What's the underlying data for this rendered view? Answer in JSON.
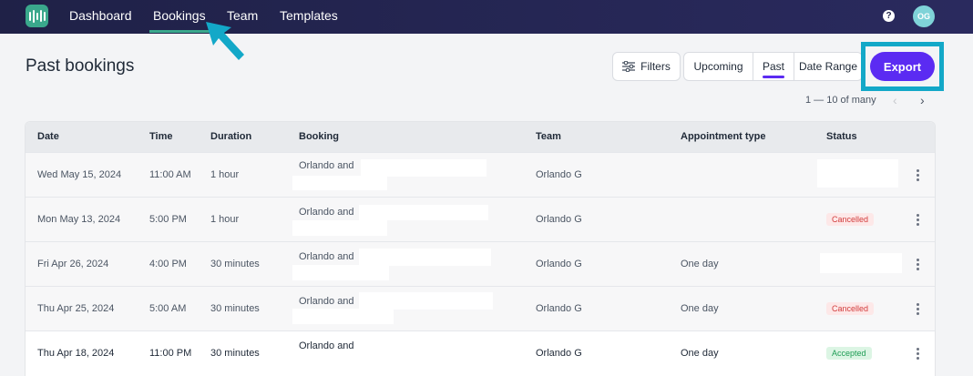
{
  "nav": {
    "items": [
      {
        "label": "Dashboard",
        "active": false
      },
      {
        "label": "Bookings",
        "active": true
      },
      {
        "label": "Team",
        "active": false
      },
      {
        "label": "Templates",
        "active": false
      }
    ],
    "help_symbol": "?",
    "avatar_initials": "OG",
    "logo_icon": "bars-logo-icon",
    "accent_color": "#3aa88c"
  },
  "page": {
    "title": "Past bookings",
    "filters_label": "Filters",
    "segments": [
      {
        "label": "Upcoming",
        "active": false
      },
      {
        "label": "Past",
        "active": true
      },
      {
        "label": "Date Range",
        "active": false
      }
    ],
    "export_label": "Export",
    "export_color": "#5b2bf2",
    "highlight_color": "#13a8c8",
    "pager_text": "1 — 10 of many",
    "prev_symbol": "‹",
    "next_symbol": "›"
  },
  "table": {
    "headers": [
      "Date",
      "Time",
      "Duration",
      "Booking",
      "Team",
      "Appointment type",
      "Status"
    ],
    "rows": [
      {
        "date": "Wed May 15, 2024",
        "time": "11:00 AM",
        "duration": "1 hour",
        "booking": "Orlando and",
        "team": "Orlando G",
        "appt": "",
        "status": "",
        "status_kind": "redacted"
      },
      {
        "date": "Mon May 13, 2024",
        "time": "5:00 PM",
        "duration": "1 hour",
        "booking": "Orlando and",
        "team": "Orlando G",
        "appt": "",
        "status": "Cancelled",
        "status_kind": "cancel"
      },
      {
        "date": "Fri Apr 26, 2024",
        "time": "4:00 PM",
        "duration": "30 minutes",
        "booking": "Orlando and",
        "team": "Orlando G",
        "appt": "One day",
        "status": "",
        "status_kind": "redacted"
      },
      {
        "date": "Thu Apr 25, 2024",
        "time": "5:00 AM",
        "duration": "30 minutes",
        "booking": "Orlando and",
        "team": "Orlando G",
        "appt": "One day",
        "status": "Cancelled",
        "status_kind": "cancel"
      },
      {
        "date": "Thu Apr 18, 2024",
        "time": "11:00 PM",
        "duration": "30 minutes",
        "booking": "Orlando and",
        "team": "Orlando G",
        "appt": "One day",
        "status": "Accepted",
        "status_kind": "accept"
      }
    ]
  }
}
